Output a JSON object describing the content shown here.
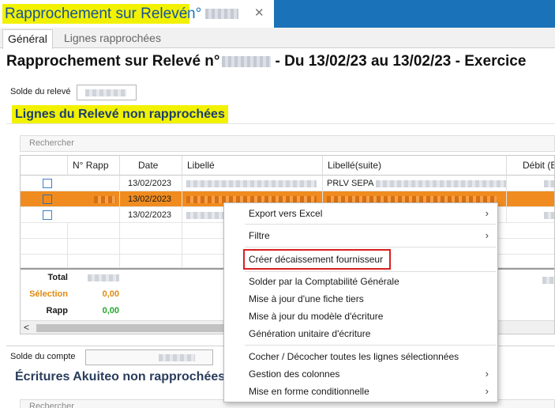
{
  "window": {
    "tab_title": "Rapprochement sur Relevé",
    "tab_num": "n°",
    "close_glyph": "✕"
  },
  "subtabs": [
    "Général",
    "Lignes rapprochées"
  ],
  "header": {
    "title_left": "Rapprochement sur Relevé n°",
    "title_right": "- Du 13/02/23 au 13/02/23 - Exercice"
  },
  "solde_releve": {
    "label": "Solde du relevé"
  },
  "section1": {
    "title": "Lignes du Relevé non rapprochées",
    "search_placeholder": "Rechercher"
  },
  "grid": {
    "columns": [
      "",
      "N° Rapp",
      "Date",
      "Libellé",
      "Libellé(suite)",
      "Débit (E"
    ],
    "rows": [
      {
        "date": "13/02/2023",
        "libelle_suite": "PRLV SEPA",
        "selected": false
      },
      {
        "date": "13/02/2023",
        "libelle_suite": "",
        "selected": true
      },
      {
        "date": "13/02/2023",
        "libelle_suite": "",
        "selected": false
      }
    ],
    "totals": {
      "total_label": "Total",
      "selection_label": "Sélection",
      "selection_value": "0,00",
      "rapp_label": "Rapp",
      "rapp_value": "0,00"
    },
    "scroll_left_glyph": "<"
  },
  "solde_compte": {
    "label": "Solde du compte"
  },
  "section2": {
    "title": "Écritures Akuiteo non rapprochées",
    "search_placeholder": "Rechercher"
  },
  "context_menu": {
    "items": [
      {
        "label": "Export vers Excel",
        "submenu": true
      },
      {
        "label": "Filtre",
        "submenu": true
      },
      {
        "label": "Créer décaissement fournisseur",
        "submenu": false,
        "highlighted": true
      },
      {
        "label": "Solder par la Comptabilité Générale",
        "submenu": false
      },
      {
        "label": "Mise à jour d'une fiche tiers",
        "submenu": false
      },
      {
        "label": "Mise à jour du modèle d'écriture",
        "submenu": false
      },
      {
        "label": "Génération unitaire d'écriture",
        "submenu": false
      },
      {
        "label": "Cocher / Décocher toutes les lignes sélectionnées",
        "submenu": false
      },
      {
        "label": "Gestion des colonnes",
        "submenu": true
      },
      {
        "label": "Mise en forme conditionnelle",
        "submenu": true
      }
    ],
    "submenu_glyph": "›"
  },
  "colors": {
    "tab_bar": "#1a73b8",
    "highlight_yellow": "#f2f200",
    "selected_row": "#f08c1f",
    "selection_orange": "#e08a10",
    "rapp_green": "#22a82a",
    "menu_highlight_border": "#d82020"
  }
}
